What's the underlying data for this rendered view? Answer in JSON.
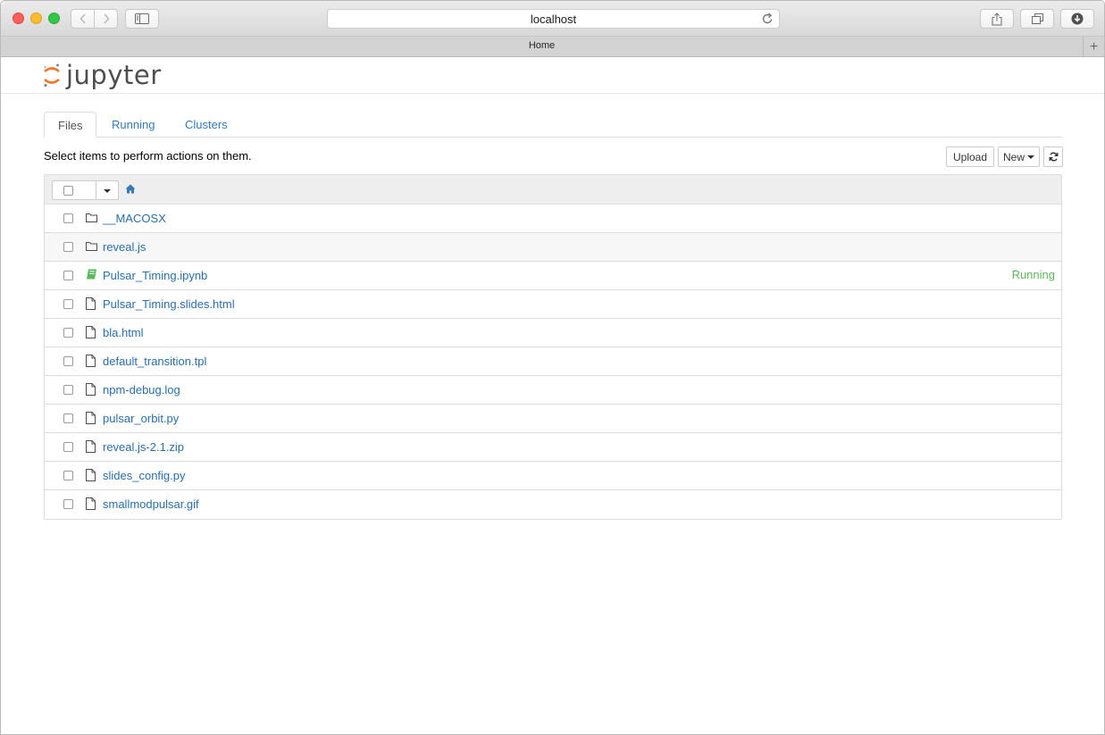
{
  "browser": {
    "address": "localhost",
    "tab_title": "Home",
    "new_tab_label": "+"
  },
  "app": {
    "logo_text": "jupyter"
  },
  "tabs": [
    {
      "label": "Files"
    },
    {
      "label": "Running"
    },
    {
      "label": "Clusters"
    }
  ],
  "toolbar": {
    "hint": "Select items to perform actions on them.",
    "upload_label": "Upload",
    "new_label": "New"
  },
  "files": [
    {
      "name": "__MACOSX",
      "type": "folder",
      "status": ""
    },
    {
      "name": "reveal.js",
      "type": "folder",
      "status": ""
    },
    {
      "name": "Pulsar_Timing.ipynb",
      "type": "notebook",
      "status": "Running"
    },
    {
      "name": "Pulsar_Timing.slides.html",
      "type": "file",
      "status": ""
    },
    {
      "name": "bla.html",
      "type": "file",
      "status": ""
    },
    {
      "name": "default_transition.tpl",
      "type": "file",
      "status": ""
    },
    {
      "name": "npm-debug.log",
      "type": "file",
      "status": ""
    },
    {
      "name": "pulsar_orbit.py",
      "type": "file",
      "status": ""
    },
    {
      "name": "reveal.js-2.1.zip",
      "type": "file",
      "status": ""
    },
    {
      "name": "slides_config.py",
      "type": "file",
      "status": ""
    },
    {
      "name": "smallmodpulsar.gif",
      "type": "file",
      "status": ""
    }
  ],
  "colors": {
    "link": "#337ab7",
    "running": "#5cb85c",
    "notebook_icon": "#5cb85c",
    "logo_orange": "#f37726"
  }
}
